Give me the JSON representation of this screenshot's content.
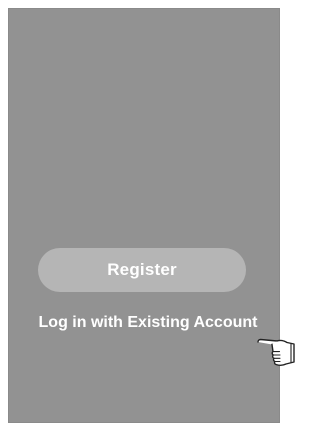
{
  "welcome": {
    "register_label": "Register",
    "login_label": "Log in with Existing Account"
  },
  "icons": {
    "pointer": "pointing-hand-icon"
  },
  "colors": {
    "screen_background": "#929292",
    "button_background": "#b5b5b5",
    "text": "#ffffff"
  }
}
